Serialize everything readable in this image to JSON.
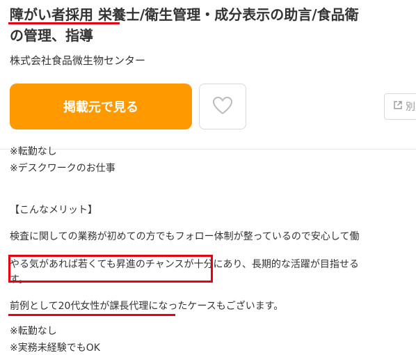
{
  "job": {
    "title_line1": "障がい者採用 栄養士/衛生管理・成分表示の助言/食品衛",
    "title_line2": "の管理、指導",
    "company": "株式会社食品微生物センター"
  },
  "actions": {
    "view_source_label": "掲載元で見る",
    "favorite_icon": "heart-icon",
    "new_window_label": "別",
    "new_window_icon": "external-link-icon"
  },
  "description": {
    "lines": [
      "※転勤なし",
      "※デスクワークのお仕事",
      "",
      "【こんなメリット】",
      "検査に関しての業務が初めての方でもフォロー体制が整っているので安心して働",
      "やる気があれば若くても昇進のチャンスが十分にあり、長期的な活躍が目指せる",
      "す。",
      "前例として20代女性が課長代理になったケースもございます。",
      "",
      "※転勤なし",
      "※実務未経験でもOK"
    ]
  },
  "colors": {
    "primary_button": "#ff9900",
    "annotation_red": "#e60012",
    "text": "#333333"
  }
}
